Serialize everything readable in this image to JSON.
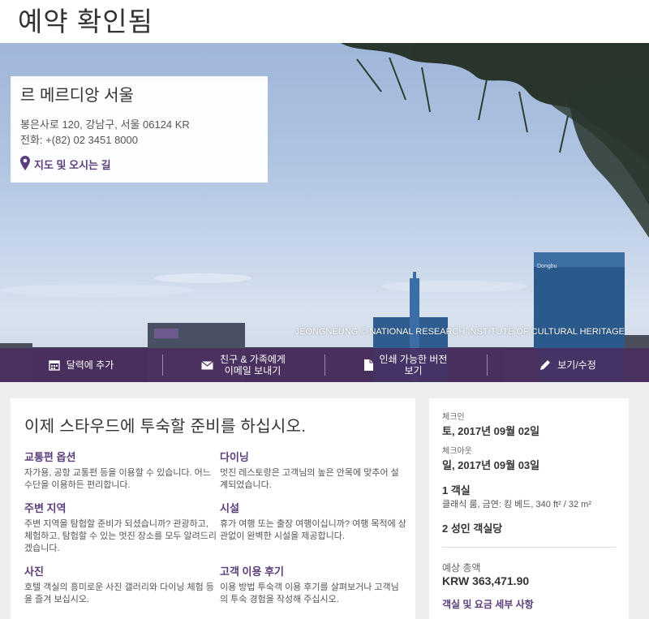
{
  "page": {
    "title": "예약 확인됨"
  },
  "hotel": {
    "name": "르 메르디앙 서울",
    "address": "봉은사로 120, 강남구, 서울 06124 KR",
    "phone": "전화: +(82) 02 3451 8000",
    "map_link": "지도 및 오시는 길"
  },
  "hero": {
    "photo_credit": "JEONGNEUNG © NATIONAL RESEARCH INSTITUTE OF CULTURAL HERITAGE",
    "building_sign": "Dongbu"
  },
  "actions": [
    {
      "label": "달력에 추가",
      "icon": "calendar-icon"
    },
    {
      "label": "친구 & 가족에게\n이메일 보내기",
      "icon": "envelope-icon"
    },
    {
      "label": "인쇄 가능한 버전\n보기",
      "icon": "document-icon"
    },
    {
      "label": "보기/수정",
      "icon": "pencil-icon"
    }
  ],
  "main": {
    "heading": "이제 스타우드에 투숙할 준비를 하십시오.",
    "tiles": [
      {
        "title": "교통편 옵션",
        "body": "자가용, 공항 교통편 등을 이용할 수 있습니다. 어느 수단을 이용하든 편리합니다."
      },
      {
        "title": "다이닝",
        "body": "멋진 레스토랑은 고객님의 높은 안목에 맞추어 설계되었습니다."
      },
      {
        "title": "주변 지역",
        "body": "주변 지역을 탐험할 준비가 되셨습니까? 관광하고, 체험하고, 탐험할 수 있는 멋진 장소를 모두 알려드리겠습니다."
      },
      {
        "title": "시설",
        "body": "휴가 여행 또는 출장 여행이십니까? 여행 목적에 상관없이 완벽한 시설을 제공합니다."
      },
      {
        "title": "사진",
        "body": "호텔 객실의 흥미로운 사진 갤러리와 다이닝 체험 등을 즐겨 보십시오."
      },
      {
        "title": "고객 이용 후기",
        "body": "이용 방법 투숙객 이용 후기를 살펴보거나 고객님의 투숙 경험을 작성해 주십시오."
      }
    ]
  },
  "booking": {
    "checkin_label": "체크인",
    "checkin_value": "토, 2017년 09월 02일",
    "checkout_label": "체크아웃",
    "checkout_value": "일, 2017년 09월 03일",
    "rooms": "1 객실",
    "room_type": "클래식 룸, 금연: 킹 베드, 340 ft² / 32 m²",
    "guests": "2 성인 객실당",
    "total_label": "예상 총액",
    "total_value": "KRW 363,471.90",
    "details_link": "객실 및 요금 세부 사항"
  },
  "colors": {
    "accent": "#5a3d7a",
    "action_bar": "#4a2c60",
    "panel_bg": "#eeeeee"
  }
}
